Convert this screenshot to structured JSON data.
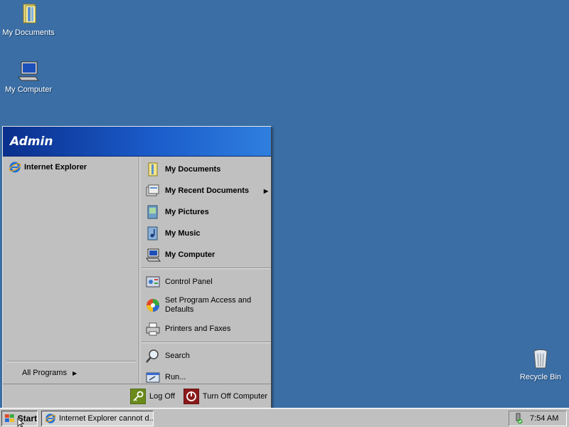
{
  "desktop": {
    "icons": [
      {
        "label": "My Documents",
        "icon": "my-documents-icon"
      },
      {
        "label": "My Computer",
        "icon": "my-computer-icon"
      },
      {
        "label": "Recycle Bin",
        "icon": "recycle-bin-icon"
      }
    ]
  },
  "start_menu": {
    "user": "Admin",
    "pinned": [
      {
        "label": "Internet Explorer",
        "icon": "internet-explorer-icon"
      }
    ],
    "all_programs_label": "All Programs",
    "right_column": {
      "group1": [
        {
          "label": "My Documents",
          "icon": "my-documents-icon"
        },
        {
          "label": "My Recent Documents",
          "icon": "recent-documents-icon",
          "submenu": true
        },
        {
          "label": "My Pictures",
          "icon": "my-pictures-icon"
        },
        {
          "label": "My Music",
          "icon": "my-music-icon"
        },
        {
          "label": "My Computer",
          "icon": "my-computer-icon"
        }
      ],
      "group2": [
        {
          "label": "Control Panel",
          "icon": "control-panel-icon"
        },
        {
          "label": "Set Program Access and Defaults",
          "icon": "program-access-icon"
        },
        {
          "label": "Printers and Faxes",
          "icon": "printers-icon"
        }
      ],
      "group3": [
        {
          "label": "Search",
          "icon": "search-icon"
        },
        {
          "label": "Run...",
          "icon": "run-icon"
        }
      ]
    },
    "footer": {
      "log_off": "Log Off",
      "turn_off": "Turn Off Computer"
    }
  },
  "taskbar": {
    "start_label": "Start",
    "task_label": "Internet Explorer cannot d...",
    "clock": "7:54 AM"
  },
  "colors": {
    "desktop": "#3a6ea5",
    "menu_header": "#0a2f8c",
    "menu_bg": "#c0c0c0"
  }
}
